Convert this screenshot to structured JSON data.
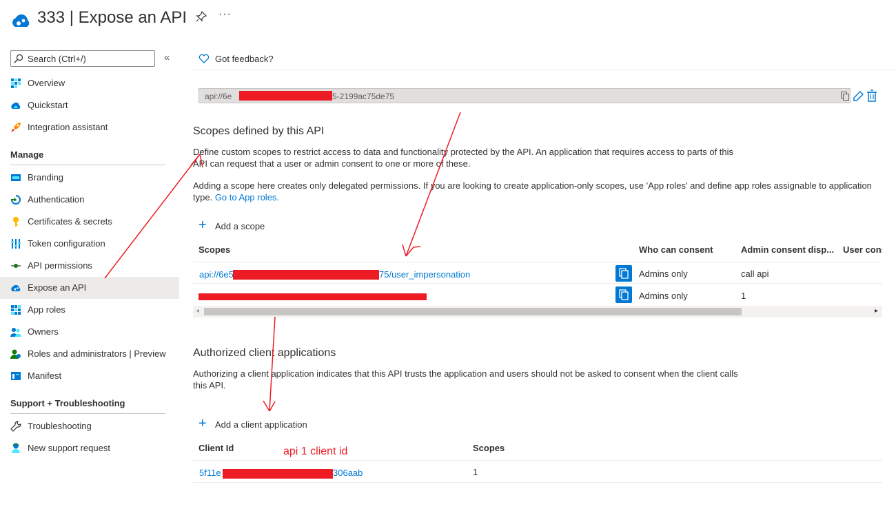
{
  "header": {
    "title": "333 | Expose an API",
    "more_label": "···"
  },
  "sidebar": {
    "search_placeholder": "Search (Ctrl+/)",
    "collapse_label": "«",
    "top_items": [
      {
        "label": "Overview",
        "icon": "overview-icon"
      },
      {
        "label": "Quickstart",
        "icon": "quickstart-icon"
      },
      {
        "label": "Integration assistant",
        "icon": "rocket-icon"
      }
    ],
    "manage_heading": "Manage",
    "manage_items": [
      {
        "label": "Branding",
        "icon": "branding-icon"
      },
      {
        "label": "Authentication",
        "icon": "authentication-icon"
      },
      {
        "label": "Certificates & secrets",
        "icon": "key-icon"
      },
      {
        "label": "Token configuration",
        "icon": "token-config-icon"
      },
      {
        "label": "API permissions",
        "icon": "api-permissions-icon"
      },
      {
        "label": "Expose an API",
        "icon": "cloud-icon",
        "active": true
      },
      {
        "label": "App roles",
        "icon": "app-roles-icon"
      },
      {
        "label": "Owners",
        "icon": "owners-icon"
      },
      {
        "label": "Roles and administrators | Preview",
        "icon": "roles-admins-icon"
      },
      {
        "label": "Manifest",
        "icon": "manifest-icon"
      }
    ],
    "support_heading": "Support + Troubleshooting",
    "support_items": [
      {
        "label": "Troubleshooting",
        "icon": "wrench-icon"
      },
      {
        "label": "New support request",
        "icon": "support-person-icon"
      }
    ]
  },
  "main": {
    "feedback_label": "Got feedback?",
    "app_id_uri": {
      "prefix": "api://6e",
      "suffix": "5-2199ac75de75"
    },
    "scopes_section": {
      "heading": "Scopes defined by this API",
      "description_1": "Define custom scopes to restrict access to data and functionality protected by the API. An application that requires access to parts of this API can request that a user or admin consent to one or more of these.",
      "description_2_prefix": "Adding a scope here creates only delegated permissions. If you are looking to create application-only scopes, use 'App roles' and define app roles assignable to application type.",
      "description_2_link": "Go to App roles.",
      "add_label": "Add a scope",
      "columns": [
        "Scopes",
        "Who can consent",
        "Admin consent disp...",
        "User cons"
      ],
      "rows": [
        {
          "scope_prefix": "api://6e5",
          "scope_suffix": "75/user_impersonation",
          "who_can_consent": "Admins only",
          "admin_consent_display": "call api"
        },
        {
          "scope_prefix": "",
          "scope_suffix": "",
          "who_can_consent": "Admins only",
          "admin_consent_display": "1"
        }
      ]
    },
    "clients_section": {
      "heading": "Authorized client applications",
      "description": "Authorizing a client application indicates that this API trusts the application and users should not be asked to consent when the client calls this API.",
      "add_label": "Add a client application",
      "columns": [
        "Client Id",
        "Scopes"
      ],
      "rows": [
        {
          "client_prefix": "5f11e",
          "client_suffix": "306aab",
          "scopes": "1"
        }
      ]
    },
    "annotation": "api 1 client id"
  }
}
